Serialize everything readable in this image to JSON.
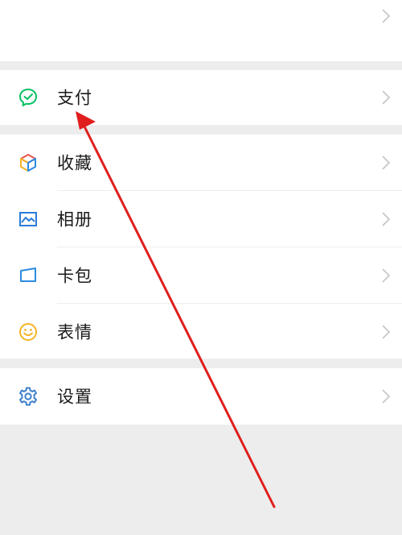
{
  "menu": {
    "pay_label": "支付",
    "favorites_label": "收藏",
    "album_label": "相册",
    "cards_label": "卡包",
    "stickers_label": "表情",
    "settings_label": "设置"
  },
  "colors": {
    "background": "#ededed",
    "row": "#ffffff",
    "text": "#1a1a1a",
    "pay_icon": "#07c160",
    "album_icon": "#2b7bd8",
    "cards_icon": "#2b8be0",
    "stickers_icon": "#f5b324",
    "settings_icon": "#3d7fc8",
    "chevron": "#c8c8c8",
    "arrow": "#e01e1e"
  },
  "icons": {
    "pay": "pay-icon",
    "favorites": "favorites-cube-icon",
    "album": "album-image-icon",
    "cards": "card-wallet-icon",
    "stickers": "smiley-face-icon",
    "settings": "gear-icon",
    "chevron": "chevron-right-icon",
    "annotation": "red-arrow-annotation"
  }
}
